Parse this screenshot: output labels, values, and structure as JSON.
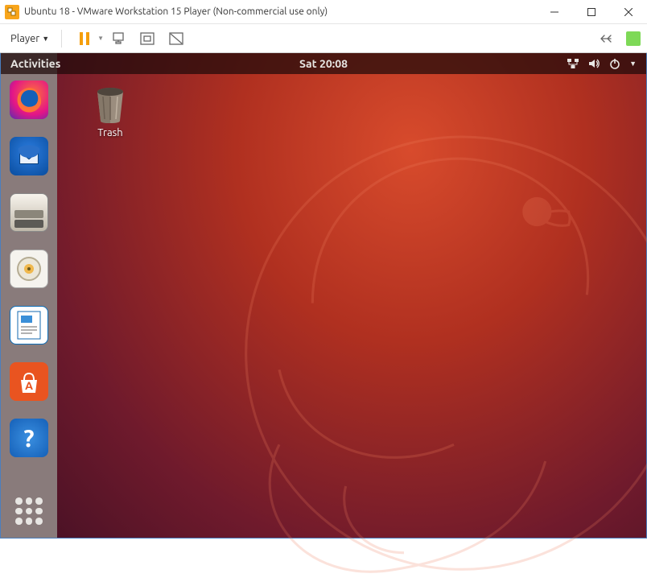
{
  "titlebar": {
    "title": "Ubuntu 18 - VMware Workstation 15 Player (Non-commercial use only)"
  },
  "vmtoolbar": {
    "menu_label": "Player"
  },
  "ubuntu": {
    "activities_label": "Activities",
    "clock": "Sat 20:08"
  },
  "desktop": {
    "trash_label": "Trash"
  },
  "dock": {
    "items": [
      {
        "name": "firefox"
      },
      {
        "name": "thunderbird"
      },
      {
        "name": "files"
      },
      {
        "name": "rhythmbox"
      },
      {
        "name": "libreoffice-writer"
      },
      {
        "name": "ubuntu-software"
      },
      {
        "name": "help"
      }
    ]
  }
}
